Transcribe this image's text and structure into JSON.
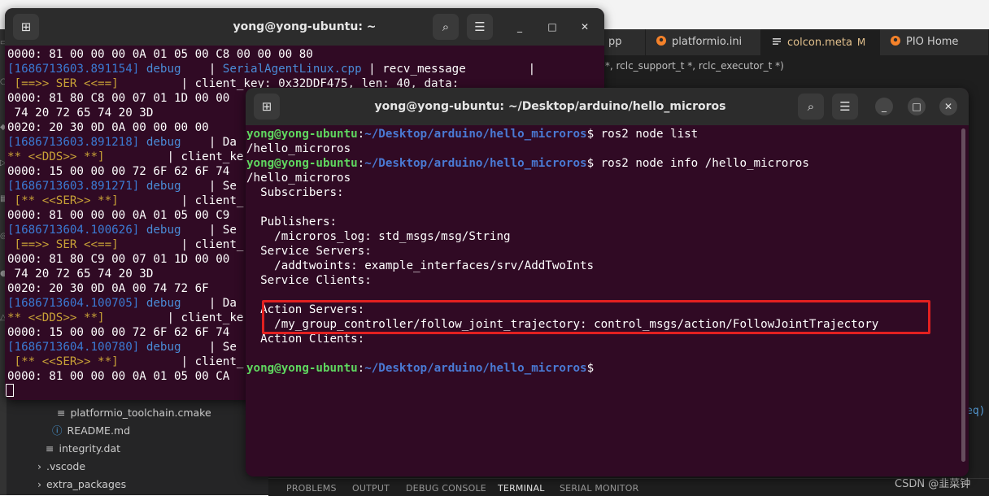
{
  "vscode": {
    "tabs": [
      {
        "label": "pp",
        "icon": "file-icon",
        "modified": ""
      },
      {
        "label": "platformio.ini",
        "icon": "platformio-icon",
        "modified": ""
      },
      {
        "label": "colcon.meta",
        "icon": "settings-file-icon",
        "modified": "M"
      },
      {
        "label": "PIO Home",
        "icon": "platformio-icon",
        "modified": ""
      }
    ],
    "breadcrumb": ": *, rclc_support_t *, rclc_executor_t *)",
    "sidebar_items": [
      {
        "label": "platformio_toolchain.cmake",
        "icon": "file-lines-icon"
      },
      {
        "label": "README.md",
        "icon": "info-icon"
      },
      {
        "label": "integrity.dat",
        "icon": "file-lines-icon"
      },
      {
        "label": ".vscode",
        "icon": "chevron-right-icon"
      },
      {
        "label": "extra_packages",
        "icon": "chevron-right-icon"
      }
    ],
    "right_code": "eq)",
    "right_code_tail": ";",
    "panel_tabs": [
      "PROBLEMS",
      "OUTPUT",
      "DEBUG CONSOLE",
      "TERMINAL",
      "SERIAL MONITOR"
    ],
    "active_panel_tab": "TERMINAL",
    "watermark": "CSDN @韭菜钟"
  },
  "terminal_back": {
    "title": "yong@yong-ubuntu: ~",
    "new_tab_icon": "⊞",
    "menu_icon": "☰",
    "search_icon": "⌕",
    "minimize": "_",
    "maximize": "□",
    "close": "✕",
    "lines": [
      [
        {
          "t": "0000: 81 00 00 00 0A 01 05 00 C8 00 00 00 80",
          "c": "white"
        }
      ],
      [
        {
          "t": "[1686713603.891154]",
          "c": "ts"
        },
        {
          "t": " debug",
          "c": "blue"
        },
        {
          "t": "    | ",
          "c": "white"
        },
        {
          "t": "SerialAgentLinux.cpp",
          "c": "blue"
        },
        {
          "t": " | recv_message         |",
          "c": "white"
        }
      ],
      [
        {
          "t": " [==>> SER <<==]",
          "c": "yel"
        },
        {
          "t": "         | client_key: 0x32DDF475, len: 40, data:",
          "c": "white"
        }
      ],
      [
        {
          "t": "0000: 81 80 C8 00 07 01 1D 00 00",
          "c": "white"
        }
      ],
      [
        {
          "t": " 74 20 72 65 74 20 3D",
          "c": "white"
        }
      ],
      [
        {
          "t": "0020: 20 30 0D 0A 00 00 00 00",
          "c": "white"
        }
      ],
      [
        {
          "t": "[1686713603.891218]",
          "c": "ts"
        },
        {
          "t": " debug",
          "c": "blue"
        },
        {
          "t": "    | Da",
          "c": "white"
        }
      ],
      [
        {
          "t": "** <<DDS>> **]",
          "c": "yel"
        },
        {
          "t": "         | client_ke",
          "c": "white"
        }
      ],
      [
        {
          "t": "0000: 15 00 00 00 72 6F 62 6F 74",
          "c": "white"
        }
      ],
      [
        {
          "t": "[1686713603.891271]",
          "c": "ts"
        },
        {
          "t": " debug",
          "c": "blue"
        },
        {
          "t": "    | Se",
          "c": "white"
        }
      ],
      [
        {
          "t": " [** <<SER>> **]",
          "c": "yel"
        },
        {
          "t": "         | client_",
          "c": "white"
        }
      ],
      [
        {
          "t": "0000: 81 00 00 00 0A 01 05 00 C9",
          "c": "white"
        }
      ],
      [
        {
          "t": "[1686713604.100626]",
          "c": "ts"
        },
        {
          "t": " debug",
          "c": "blue"
        },
        {
          "t": "    | Se",
          "c": "white"
        }
      ],
      [
        {
          "t": " [==>> SER <<==]",
          "c": "yel"
        },
        {
          "t": "         | client_",
          "c": "white"
        }
      ],
      [
        {
          "t": "0000: 81 80 C9 00 07 01 1D 00 00",
          "c": "white"
        }
      ],
      [
        {
          "t": " 74 20 72 65 74 20 3D",
          "c": "white"
        }
      ],
      [
        {
          "t": "0020: 20 30 0D 0A 00 74 72 6F",
          "c": "white"
        }
      ],
      [
        {
          "t": "[1686713604.100705]",
          "c": "ts"
        },
        {
          "t": " debug",
          "c": "blue"
        },
        {
          "t": "    | Da",
          "c": "white"
        }
      ],
      [
        {
          "t": "** <<DDS>> **]",
          "c": "yel"
        },
        {
          "t": "         | client_ke",
          "c": "white"
        }
      ],
      [
        {
          "t": "0000: 15 00 00 00 72 6F 62 6F 74",
          "c": "white"
        }
      ],
      [
        {
          "t": "[1686713604.100780]",
          "c": "ts"
        },
        {
          "t": " debug",
          "c": "blue"
        },
        {
          "t": "    | Se",
          "c": "white"
        }
      ],
      [
        {
          "t": " [** <<SER>> **]",
          "c": "yel"
        },
        {
          "t": "         | client_",
          "c": "white"
        }
      ],
      [
        {
          "t": "0000: 81 00 00 00 0A 01 05 00 CA",
          "c": "white"
        }
      ]
    ]
  },
  "terminal_front": {
    "title": "yong@yong-ubuntu: ~/Desktop/arduino/hello_microros",
    "new_tab_icon": "⊞",
    "menu_icon": "☰",
    "search_icon": "⌕",
    "minimize": "_",
    "maximize": "□",
    "close": "✕",
    "prompt_user": "yong@yong-ubuntu",
    "prompt_path": "~/Desktop/arduino/hello_microros",
    "lines": [
      [
        {
          "t": "yong@yong-ubuntu",
          "c": "prompt"
        },
        {
          "t": ":",
          "c": "white"
        },
        {
          "t": "~/Desktop/arduino/hello_microros",
          "c": "path"
        },
        {
          "t": "$ ros2 node list",
          "c": "white"
        }
      ],
      [
        {
          "t": "/hello_microros",
          "c": "white"
        }
      ],
      [
        {
          "t": "yong@yong-ubuntu",
          "c": "prompt"
        },
        {
          "t": ":",
          "c": "white"
        },
        {
          "t": "~/Desktop/arduino/hello_microros",
          "c": "path"
        },
        {
          "t": "$ ros2 node info /hello_microros",
          "c": "white"
        }
      ],
      [
        {
          "t": "/hello_microros",
          "c": "white"
        }
      ],
      [
        {
          "t": "  Subscribers:",
          "c": "white"
        }
      ],
      [
        {
          "t": "",
          "c": "white"
        }
      ],
      [
        {
          "t": "  Publishers:",
          "c": "white"
        }
      ],
      [
        {
          "t": "    /microros_log: std_msgs/msg/String",
          "c": "white"
        }
      ],
      [
        {
          "t": "  Service Servers:",
          "c": "white"
        }
      ],
      [
        {
          "t": "    /addtwoints: example_interfaces/srv/AddTwoInts",
          "c": "white"
        }
      ],
      [
        {
          "t": "  Service Clients:",
          "c": "white"
        }
      ],
      [
        {
          "t": "",
          "c": "white"
        }
      ],
      [
        {
          "t": "  Action Servers:",
          "c": "white"
        }
      ],
      [
        {
          "t": "    /my_group_controller/follow_joint_trajectory: control_msgs/action/FollowJointTrajectory",
          "c": "white"
        }
      ],
      [
        {
          "t": "  Action Clients:",
          "c": "white"
        }
      ],
      [
        {
          "t": "",
          "c": "white"
        }
      ],
      [
        {
          "t": "yong@yong-ubuntu",
          "c": "prompt"
        },
        {
          "t": ":",
          "c": "white"
        },
        {
          "t": "~/Desktop/arduino/hello_microros",
          "c": "path"
        },
        {
          "t": "$",
          "c": "white"
        }
      ]
    ]
  },
  "colors": {
    "terminal_bg": "#300a24",
    "highlight": "#e22020",
    "prompt_green": "#5fd75f",
    "prompt_blue": "#4a7ad4"
  }
}
